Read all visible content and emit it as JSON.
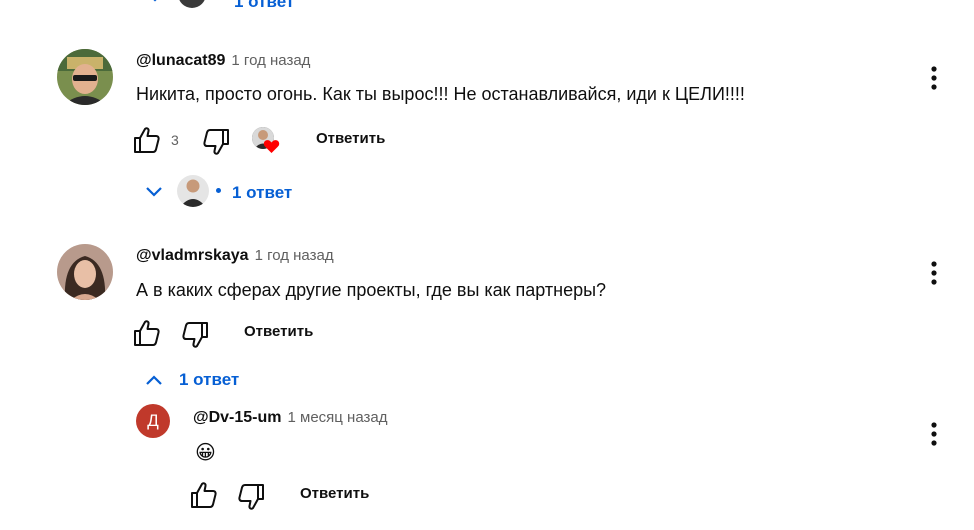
{
  "top_partial": {
    "replies_label": "1 ответ"
  },
  "comments": [
    {
      "handle": "@lunacat89",
      "time": "1 год назад",
      "text": "Никита, просто огонь. Как ты вырос!!! Не останавливайся, иди к ЦЕЛИ!!!!",
      "likes": "3",
      "reply_label": "Ответить",
      "replies_label": "1 ответ",
      "replies_expanded": false,
      "creator_heart": true
    },
    {
      "handle": "@vladmrskaya",
      "time": "1 год назад",
      "text": "А в каких сферах другие проекты, где вы как партнеры?",
      "likes": "",
      "reply_label": "Ответить",
      "replies_label": "1 ответ",
      "replies_expanded": true
    }
  ],
  "reply": {
    "avatar_letter": "Д",
    "avatar_color": "#c0392b",
    "handle": "@Dv-15-um",
    "time": "1 месяц назад",
    "text": "😀",
    "reply_label": "Ответить"
  },
  "colors": {
    "link": "#065fd4",
    "meta": "#606060",
    "text": "#0f0f0f",
    "heart": "#ff0000"
  },
  "icons": [
    "like-icon",
    "dislike-icon",
    "more-vert-icon",
    "chevron-down-icon",
    "chevron-up-icon",
    "heart-icon"
  ]
}
